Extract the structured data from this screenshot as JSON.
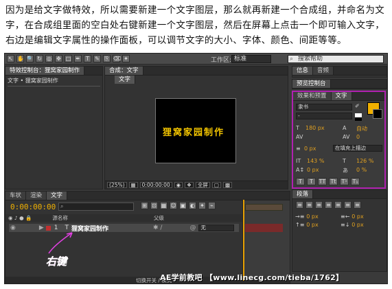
{
  "caption": {
    "lines": [
      "因为是给文字做特效，所以需要新建一个文字图层，那么就再新建一个合成组，并命名为文",
      "字，在合成组里面的空白处右键新建一个文字图层，然后在屏幕上点击一个即可输入文字，",
      "右边是编辑文字属性的操作面板，可以调节文字的大小、字体、颜色、间距等等。"
    ]
  },
  "toolbar": {
    "workspace_label": "工作区:",
    "workspace_value": "标准",
    "search_placeholder": "搜索帮助"
  },
  "project_panel": {
    "tab": "特效控制台：狸窝家园制作",
    "breadcrumb": "文字 • 狸窝家园制作"
  },
  "comp_panel": {
    "tab": "合成：文字",
    "subtab": "文字",
    "canvas_text": "狸窝家园制作",
    "zoom": "(25%)",
    "timecode": "0:00:00:00",
    "resolution": "全屏"
  },
  "right_panels": {
    "info_tab": "信息",
    "audio_tab": "音频",
    "preview_tab": "预览控制台",
    "effects_tab": "效果和预置",
    "character_tab": "文字",
    "paragraph_tab": "段落"
  },
  "character": {
    "font": "隶书",
    "style": "-",
    "size": "180 px",
    "leading": "自动",
    "kerning": "",
    "tracking": "0",
    "stroke_width": "0 px",
    "stroke_mode": "在填充上描边",
    "vscale": "143 %",
    "hscale": "126 %",
    "baseline": "0 px",
    "tsume": "0 %",
    "colors": {
      "fill": "#f0b000",
      "stroke": "#000000"
    }
  },
  "paragraph": {
    "indent_left": "0 px",
    "indent_right": "0 px",
    "space_before": "0 px",
    "space_after": "0 px"
  },
  "timeline": {
    "tabs": [
      "车状",
      "渲染",
      "文字"
    ],
    "active_tab": "文字",
    "timecode": "0:00:00:00",
    "col_source": "源名称",
    "col_parent": "父级",
    "layer_number": "1",
    "layer_name": "狸窝家园制作",
    "parent_value": "无",
    "footer_label": "切换开关 / 模式"
  },
  "annotation": "右键",
  "watermark": "AE学前教吧 【www.linecg.com/tieba/1762】"
}
